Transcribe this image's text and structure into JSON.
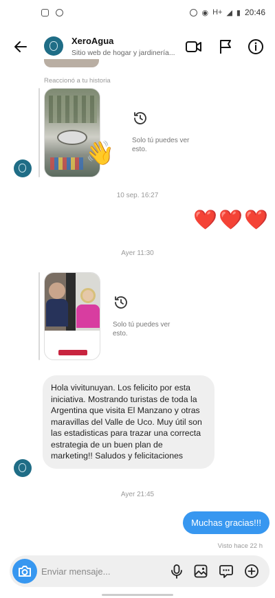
{
  "status_bar": {
    "time": "20:46",
    "signal_text": "H+",
    "left_icons": [
      "instagram-icon",
      "sync-icon"
    ],
    "right_icons": [
      "alarm-icon",
      "eye-icon",
      "signal-icon",
      "battery-icon"
    ]
  },
  "header": {
    "name": "XeroAgua",
    "subtitle": "Sitio web de hogar y jardinería...",
    "actions": [
      "video-call-icon",
      "flag-icon",
      "info-icon"
    ]
  },
  "thread": {
    "reacted_label": "Reaccionó a tu historia",
    "story1_note": "Solo tú puedes ver esto.",
    "timestamp1": "10 sep. 16:27",
    "hearts": "❤️❤️❤️",
    "timestamp2": "Ayer 11:30",
    "story2_note": "Solo tú puedes ver esto.",
    "incoming_message": "Hola vivitunuyan. Los felicito por esta iniciativa. Mostrando turistas de toda la Argentina que visita El Manzano y otras maravillas del Valle de Uco. Muy útil son las estadisticas para trazar una correcta estrategia de un buen plan de marketing!! Saludos y felicitaciones",
    "timestamp3": "Ayer 21:45",
    "outgoing_message": "Muchas gracias!!!",
    "seen_label": "Visto hace 22 h"
  },
  "composer": {
    "placeholder": "Enviar mensaje...",
    "actions": [
      "microphone-icon",
      "gallery-icon",
      "sticker-icon",
      "add-icon"
    ]
  },
  "colors": {
    "accent_blue": "#3797f0",
    "bubble_gray": "#efefef",
    "avatar_teal": "#1f6d86",
    "heart_red": "#e3262e"
  }
}
